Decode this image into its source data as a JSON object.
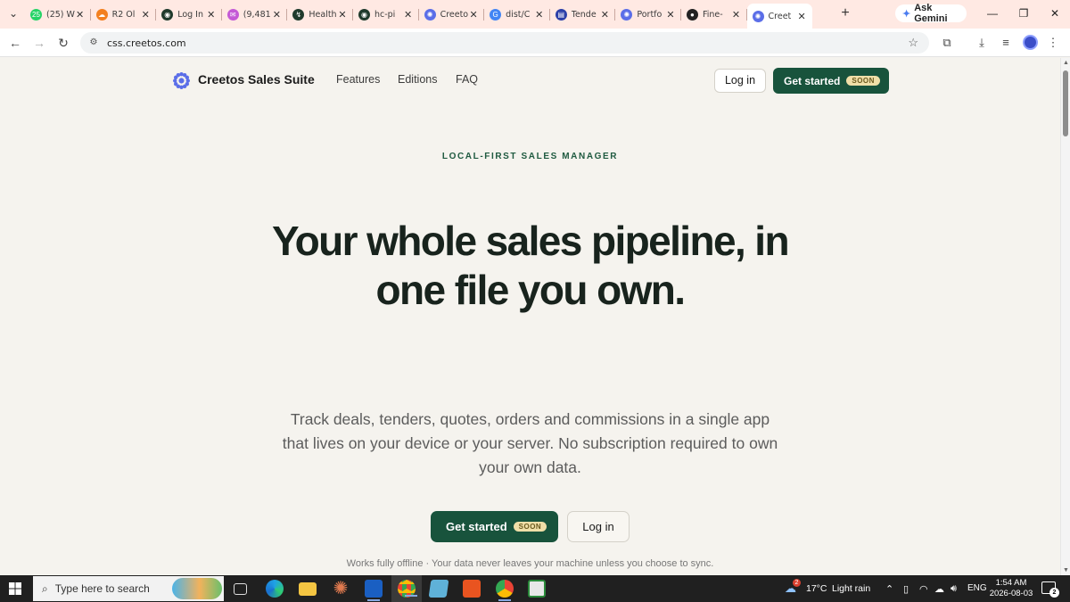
{
  "browser": {
    "tabs": [
      {
        "title": "(25) W",
        "icon": "whatsapp-icon",
        "color": "#25d366",
        "glyph": "25"
      },
      {
        "title": "R2 Ol",
        "icon": "cloudflare-icon",
        "color": "#f38020",
        "glyph": "☁"
      },
      {
        "title": "Log In",
        "icon": "app-icon",
        "color": "#1f3a2c",
        "glyph": "◉"
      },
      {
        "title": "(9,481",
        "icon": "mail-icon",
        "color": "#c45ad6",
        "glyph": "✉"
      },
      {
        "title": "Health",
        "icon": "health-icon",
        "color": "#1f3a2c",
        "glyph": "↯"
      },
      {
        "title": "hc-pi",
        "icon": "app-icon",
        "color": "#1f3a2c",
        "glyph": "◉"
      },
      {
        "title": "Creeto",
        "icon": "creetos-icon",
        "color": "#5b6ee8",
        "glyph": "✺"
      },
      {
        "title": "dist/C",
        "icon": "google-icon",
        "color": "#4285f4",
        "glyph": "G"
      },
      {
        "title": "Tende",
        "icon": "tender-icon",
        "color": "#2b3fa8",
        "glyph": "▤"
      },
      {
        "title": "Portfo",
        "icon": "creetos-icon",
        "color": "#5b6ee8",
        "glyph": "✺"
      },
      {
        "title": "Fine-",
        "icon": "github-icon",
        "color": "#222222",
        "glyph": "●"
      },
      {
        "title": "Creet",
        "icon": "creetos-icon",
        "color": "#5b6ee8",
        "glyph": "✺",
        "active": true
      }
    ],
    "new_tab_label": "+",
    "gemini_label": "Ask Gemini",
    "window_controls": {
      "minimize": "—",
      "restore": "❐",
      "close": "✕"
    },
    "url": "css.creetos.com"
  },
  "site": {
    "brand": "Creetos Sales Suite",
    "nav": [
      "Features",
      "Editions",
      "FAQ"
    ],
    "login_label": "Log in",
    "get_started_label": "Get started",
    "soon_badge": "SOON",
    "eyebrow": "LOCAL-FIRST SALES MANAGER",
    "headline": "Your whole sales pipeline, in one file you own.",
    "subcopy": "Track deals, tenders, quotes, orders and commissions in a single app that lives on your device or your server. No subscription required to own your own data.",
    "footnote": "Works fully offline · Your data never leaves your machine unless you choose to sync.",
    "accent_color": "#18533c"
  },
  "taskbar": {
    "search_placeholder": "Type here to search",
    "weather_temp": "17°C",
    "weather_text": "Light rain",
    "weather_badge": "2",
    "language": "ENG",
    "time": "1:54 AM",
    "date": "2026-08-03",
    "notification_count": "2",
    "apps": [
      "task-view-icon",
      "edge-icon",
      "file-explorer-icon",
      "claude-icon",
      "outlook-icon",
      "chrome-icon",
      "notes-icon",
      "ubuntu-icon",
      "chrome-profile-icon",
      "terminal-icon"
    ]
  }
}
